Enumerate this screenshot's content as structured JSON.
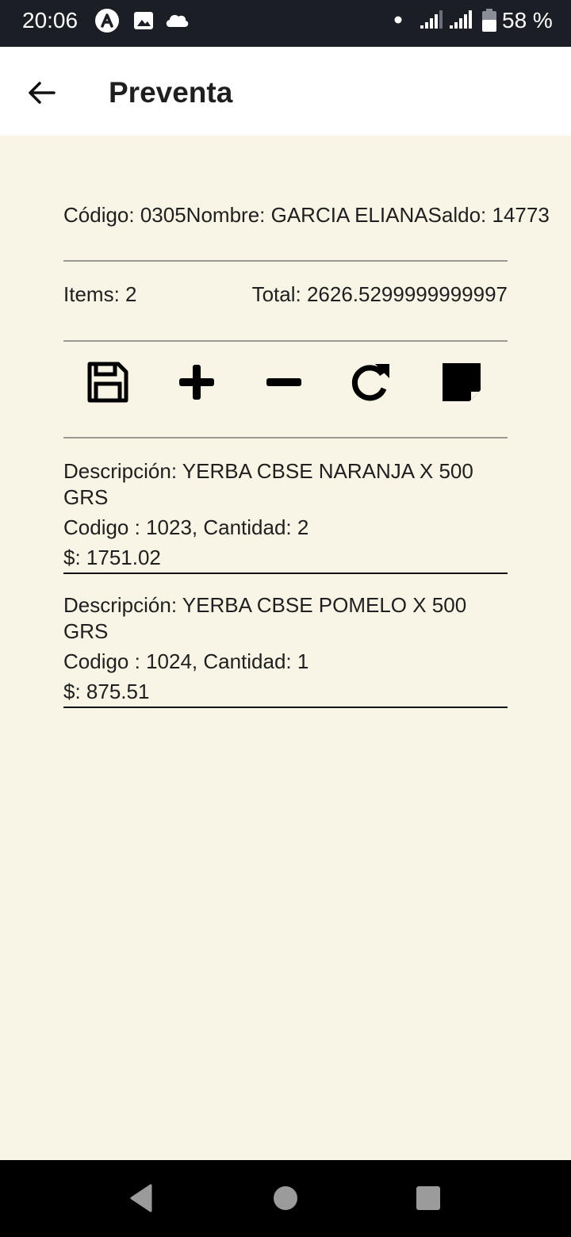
{
  "status_bar": {
    "time": "20:06",
    "battery": "58 %",
    "left_icons": [
      "assistant-icon",
      "image-icon",
      "cloud-icon"
    ],
    "right_icons": [
      "dot-icon",
      "signal-icon",
      "signal-icon",
      "battery-icon"
    ]
  },
  "app_bar": {
    "title": "Preventa",
    "back_icon": "arrow-left-icon"
  },
  "client": {
    "info": "Código: 0305Nombre: GARCIA ELIANASaldo: 14773"
  },
  "summary": {
    "items": "Items: 2",
    "total": "Total: 2626.5299999999997"
  },
  "toolbar": {
    "icons": [
      "save-icon",
      "plus-icon",
      "minus-icon",
      "refresh-icon",
      "note-icon"
    ]
  },
  "products": [
    {
      "description": "Descripción: YERBA CBSE NARANJA X 500 GRS",
      "code_qty": "Codigo : 1023, Cantidad: 2",
      "price": "$: 1751.02"
    },
    {
      "description": "Descripción: YERBA CBSE POMELO X 500 GRS",
      "code_qty": "Codigo : 1024, Cantidad: 1",
      "price": "$: 875.51"
    }
  ],
  "nav_bar": {
    "icons": [
      "back-triangle-icon",
      "home-circle-icon",
      "recents-square-icon"
    ]
  },
  "colors": {
    "status_bar": "#1b1e25",
    "app_bar": "#ffffff",
    "content_bg": "#f8f4e6",
    "nav_bar": "#000000",
    "text": "#1f1f1f"
  }
}
